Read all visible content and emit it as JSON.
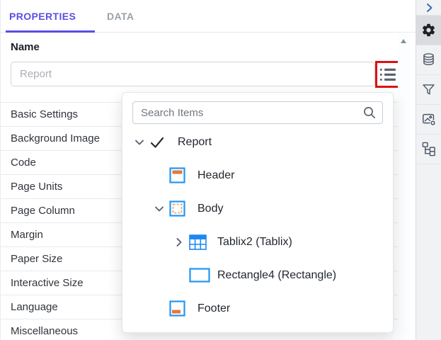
{
  "tabs": {
    "properties": "PROPERTIES",
    "data": "DATA"
  },
  "name_field": {
    "label": "Name",
    "placeholder": "Report"
  },
  "properties_list": [
    "Basic Settings",
    "Background Image",
    "Code",
    "Page Units",
    "Page Column",
    "Margin",
    "Paper Size",
    "Interactive Size",
    "Language",
    "Miscellaneous"
  ],
  "dropdown": {
    "search_placeholder": "Search Items",
    "tree": [
      {
        "label": "Report",
        "level": 0,
        "expander": "down",
        "icon": "check-icon"
      },
      {
        "label": "Header",
        "level": 1,
        "expander": "none",
        "icon": "header-icon"
      },
      {
        "label": "Body",
        "level": 1,
        "expander": "down",
        "icon": "body-icon"
      },
      {
        "label": "Tablix2 (Tablix)",
        "level": 2,
        "expander": "right",
        "icon": "tablix-icon"
      },
      {
        "label": "Rectangle4 (Rectangle)",
        "level": 2,
        "expander": "none",
        "icon": "rectangle-icon"
      },
      {
        "label": "Footer",
        "level": 1,
        "expander": "none",
        "icon": "footer-icon"
      }
    ]
  },
  "right_toolbar": {
    "items": [
      "collapse-panel",
      "properties-settings",
      "data-sources",
      "filters",
      "image-settings",
      "report-structure"
    ],
    "active_item": "properties-settings"
  },
  "colors": {
    "accent_purple": "#5b4ee4",
    "inactive_tab_gray": "#9ba1a9",
    "highlight_red": "#e01111",
    "element_blue": "#2196f3",
    "element_orange": "#e2793c",
    "toolbar_icon": "#4a5568"
  }
}
